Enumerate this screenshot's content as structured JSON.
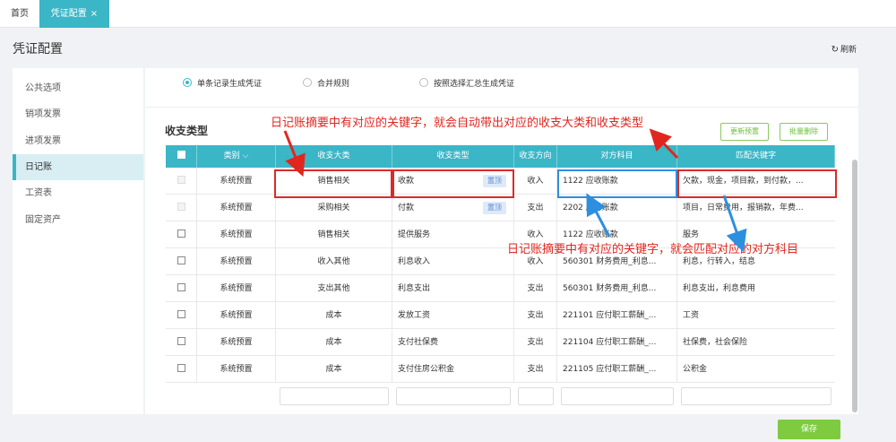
{
  "tabs": {
    "home": "首页",
    "active": "凭证配置",
    "close": "×"
  },
  "header": {
    "title": "凭证配置",
    "refresh": "刷新"
  },
  "sidebar": {
    "items": [
      "公共选项",
      "销项发票",
      "进项发票",
      "日记账",
      "工资表",
      "固定资产"
    ]
  },
  "radios": [
    "单条记录生成凭证",
    "合并规则",
    "按照选择汇总生成凭证"
  ],
  "section": {
    "title": "收支类型",
    "btn_update": "更新预置",
    "btn_delete": "批量删除"
  },
  "table": {
    "headers": {
      "category": "类别",
      "major": "收支大类",
      "type": "收支类型",
      "direction": "收支方向",
      "account": "对方科目",
      "keywords": "匹配关键字"
    },
    "rows": [
      {
        "category": "系统预置",
        "major": "销售相关",
        "type": "收款",
        "tag": "置顶",
        "direction": "收入",
        "account": "1122 应收账款",
        "keywords": "欠款，现金，项目款，到付款，..."
      },
      {
        "category": "系统预置",
        "major": "采购相关",
        "type": "付款",
        "tag": "置顶",
        "direction": "支出",
        "account": "2202 应付账款",
        "keywords": "项目，日常费用，报销款，年费..."
      },
      {
        "category": "系统预置",
        "major": "销售相关",
        "type": "提供服务",
        "tag": "",
        "direction": "收入",
        "account": "1122 应收账款",
        "keywords": "服务"
      },
      {
        "category": "系统预置",
        "major": "收入其他",
        "type": "利息收入",
        "tag": "",
        "direction": "收入",
        "account": "560301 财务费用_利息...",
        "keywords": "利息，行转入，结息"
      },
      {
        "category": "系统预置",
        "major": "支出其他",
        "type": "利息支出",
        "tag": "",
        "direction": "支出",
        "account": "560301 财务费用_利息...",
        "keywords": "利息支出，利息费用"
      },
      {
        "category": "系统预置",
        "major": "成本",
        "type": "发放工资",
        "tag": "",
        "direction": "支出",
        "account": "221101 应付职工薪酬_...",
        "keywords": "工资"
      },
      {
        "category": "系统预置",
        "major": "成本",
        "type": "支付社保费",
        "tag": "",
        "direction": "支出",
        "account": "221104 应付职工薪酬_...",
        "keywords": "社保费，社会保险"
      },
      {
        "category": "系统预置",
        "major": "成本",
        "type": "支付住房公积金",
        "tag": "",
        "direction": "支出",
        "account": "221105 应付职工薪酬_...",
        "keywords": "公积金"
      }
    ]
  },
  "annotations": {
    "top": "日记账摘要中有对应的关键字，就会自动带出对应的收支大类和收支类型",
    "middle": "日记账摘要中有对应的关键字，就会匹配对应的对方科目"
  },
  "footer": {
    "save": "保存"
  },
  "colors": {
    "accent": "#3bb6c7",
    "annotation_red": "#e0261f",
    "annotation_blue": "#2c8fe0",
    "save_green": "#7ecb3f"
  }
}
